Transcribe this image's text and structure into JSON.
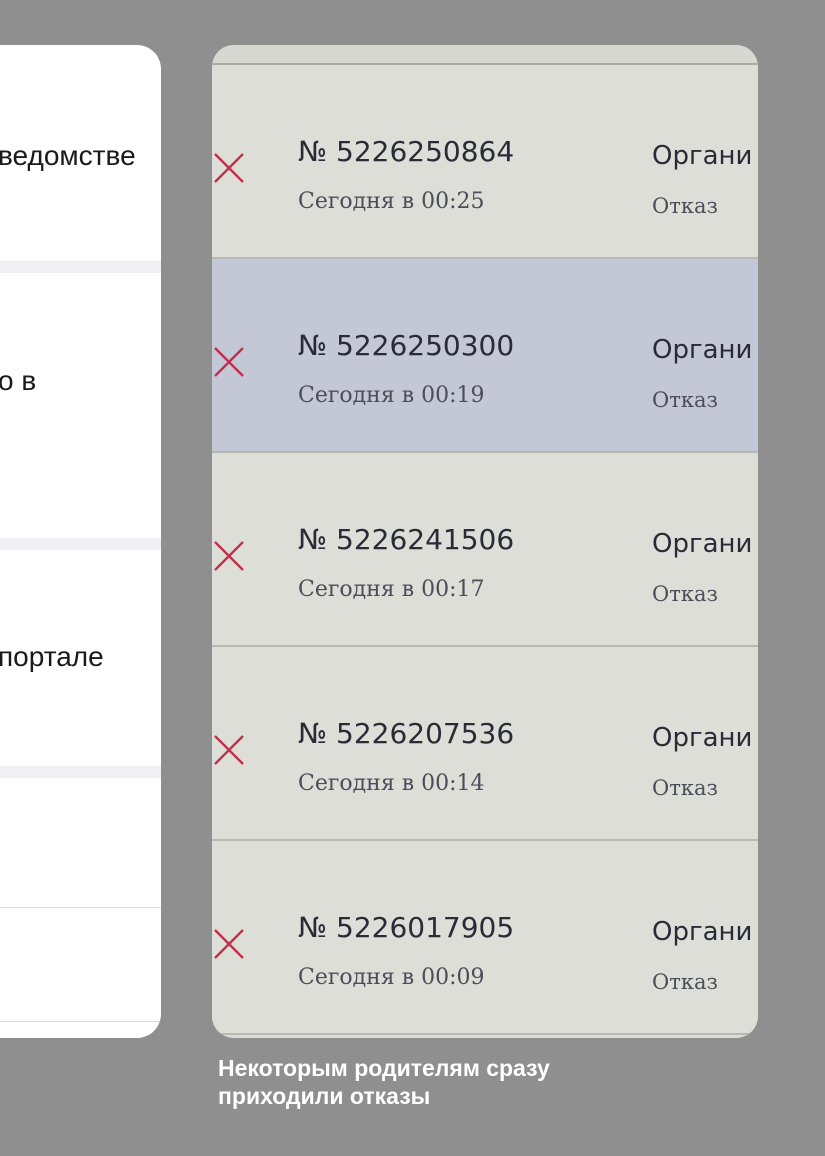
{
  "left_panel": {
    "fragments": [
      "ведомстве",
      "о в",
      "портале"
    ]
  },
  "applications": [
    {
      "number": "№ 5226250864",
      "time": "Сегодня в 00:25",
      "org": "Органи",
      "status": "Отказ",
      "selected": false
    },
    {
      "number": "№ 5226250300",
      "time": "Сегодня в 00:19",
      "org": "Органи",
      "status": "Отказ",
      "selected": true
    },
    {
      "number": "№ 5226241506",
      "time": "Сегодня в 00:17",
      "org": "Органи",
      "status": "Отказ",
      "selected": false
    },
    {
      "number": "№ 5226207536",
      "time": "Сегодня в 00:14",
      "org": "Органи",
      "status": "Отказ",
      "selected": false
    },
    {
      "number": "№ 5226017905",
      "time": "Сегодня в 00:09",
      "org": "Органи",
      "status": "Отказ",
      "selected": false
    }
  ],
  "status_icon": "cross-icon",
  "colors": {
    "background": "#8f8f8f",
    "reject_mark": "#c0304a",
    "selected_row": "#c3c7d6"
  },
  "caption": {
    "line1": "Некоторым родителям сразу",
    "line2": "приходили отказы"
  }
}
